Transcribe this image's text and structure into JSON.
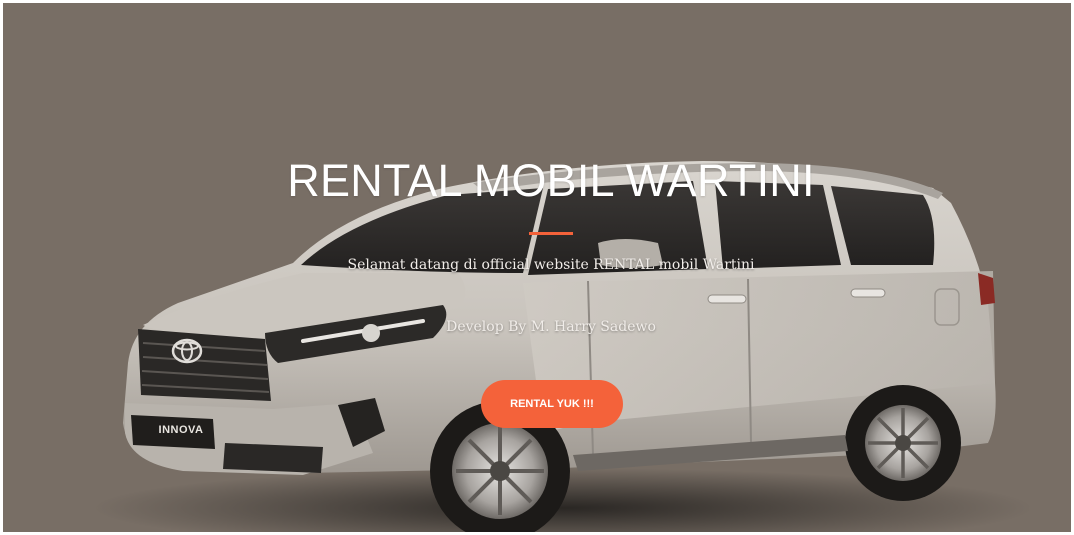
{
  "hero": {
    "title": "RENTAL MOBIL WARTINI",
    "subtitle": "Selamat datang di official website RENTAL mobil Wartini",
    "credit": "Develop By M. Harry Sadewo",
    "cta_label": "RENTAL YUK !!!",
    "car_badge": "INNOVA"
  },
  "colors": {
    "background": "#786e65",
    "accent": "#f4623a",
    "text": "#ffffff"
  },
  "icons": {
    "car": "car-image",
    "logo": "toyota-logo-icon"
  }
}
